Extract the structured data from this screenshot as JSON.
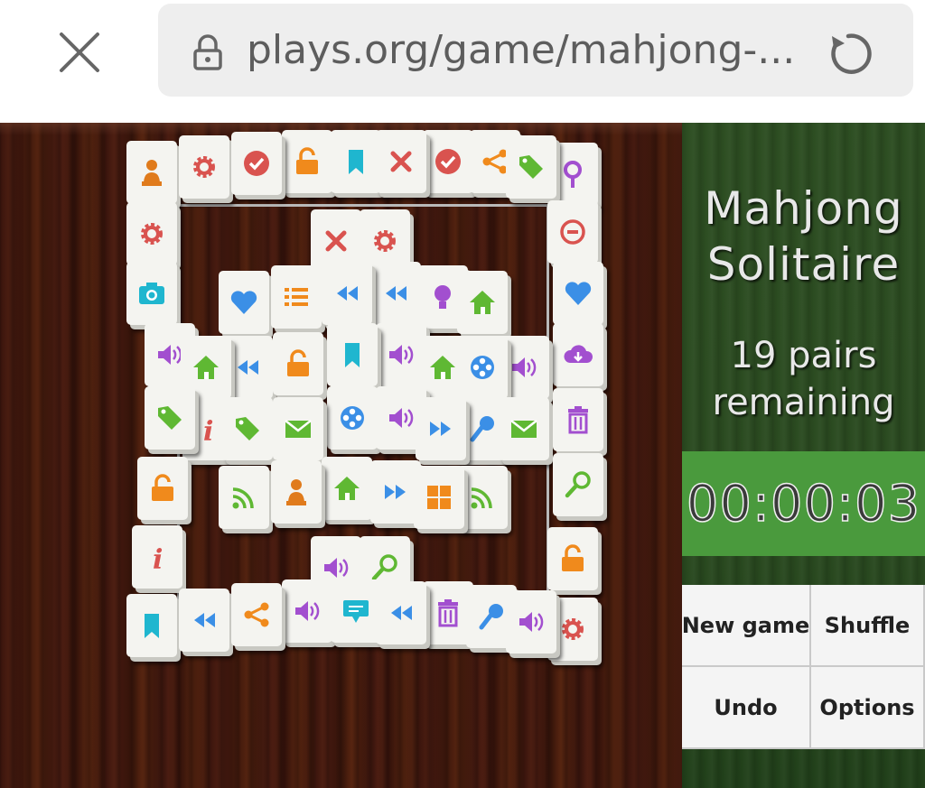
{
  "browser": {
    "url": "plays.org/game/mahjong-...",
    "close_icon": "close-icon",
    "lock_icon": "lock-icon",
    "reload_icon": "reload-icon"
  },
  "game": {
    "title_line1": "Mahjong",
    "title_line2": "Solitaire",
    "pairs_line1": "19 pairs",
    "pairs_line2": "remaining",
    "timer": "00:00:03",
    "buttons": {
      "new_game": "New game",
      "shuffle": "Shuffle",
      "undo": "Undo",
      "options": "Options"
    },
    "colors": {
      "timer_bg": "#4a9a3d",
      "panel_bg": "#2d4e22"
    },
    "tiles": [
      {
        "icon": "person",
        "color": "#e07b1c"
      },
      {
        "icon": "gear",
        "color": "#d9534f"
      },
      {
        "icon": "check",
        "color": "#d9534f"
      },
      {
        "icon": "unlock",
        "color": "#f08a1c"
      },
      {
        "icon": "bookmark",
        "color": "#1fb6cf"
      },
      {
        "icon": "x",
        "color": "#d9534f"
      },
      {
        "icon": "check",
        "color": "#d9534f"
      },
      {
        "icon": "share",
        "color": "#f08a1c"
      },
      {
        "icon": "tag",
        "color": "#5fb833"
      },
      {
        "icon": "pin",
        "color": "#a24fcf"
      },
      {
        "icon": "gear",
        "color": "#d9534f"
      },
      {
        "icon": "minus-circle",
        "color": "#d9534f"
      },
      {
        "icon": "x",
        "color": "#d9534f"
      },
      {
        "icon": "gear",
        "color": "#d9534f"
      },
      {
        "icon": "camera",
        "color": "#1fb6cf"
      },
      {
        "icon": "heart",
        "color": "#3b8fe6"
      },
      {
        "icon": "list",
        "color": "#f08a1c"
      },
      {
        "icon": "rewind",
        "color": "#3b8fe6"
      },
      {
        "icon": "rewind",
        "color": "#3b8fe6"
      },
      {
        "icon": "bulb",
        "color": "#a24fcf"
      },
      {
        "icon": "home",
        "color": "#5fb833"
      },
      {
        "icon": "heart",
        "color": "#3b8fe6"
      },
      {
        "icon": "volume",
        "color": "#a24fcf"
      },
      {
        "icon": "home",
        "color": "#5fb833"
      },
      {
        "icon": "rewind",
        "color": "#3b8fe6"
      },
      {
        "icon": "unlock",
        "color": "#f08a1c"
      },
      {
        "icon": "bookmark",
        "color": "#1fb6cf"
      },
      {
        "icon": "volume",
        "color": "#a24fcf"
      },
      {
        "icon": "home",
        "color": "#5fb833"
      },
      {
        "icon": "film",
        "color": "#3b8fe6"
      },
      {
        "icon": "volume",
        "color": "#a24fcf"
      },
      {
        "icon": "cloud",
        "color": "#a24fcf"
      },
      {
        "icon": "tag",
        "color": "#5fb833"
      },
      {
        "icon": "info",
        "color": "#d9534f"
      },
      {
        "icon": "tag",
        "color": "#5fb833"
      },
      {
        "icon": "mail",
        "color": "#5fb833"
      },
      {
        "icon": "film",
        "color": "#3b8fe6"
      },
      {
        "icon": "volume",
        "color": "#a24fcf"
      },
      {
        "icon": "forward",
        "color": "#3b8fe6"
      },
      {
        "icon": "mic",
        "color": "#3b8fe6"
      },
      {
        "icon": "mail",
        "color": "#5fb833"
      },
      {
        "icon": "trash",
        "color": "#a24fcf"
      },
      {
        "icon": "unlock",
        "color": "#f08a1c"
      },
      {
        "icon": "rss",
        "color": "#5fb833"
      },
      {
        "icon": "person",
        "color": "#e07b1c"
      },
      {
        "icon": "home",
        "color": "#5fb833"
      },
      {
        "icon": "forward",
        "color": "#3b8fe6"
      },
      {
        "icon": "grid",
        "color": "#f08a1c"
      },
      {
        "icon": "rss",
        "color": "#5fb833"
      },
      {
        "icon": "search",
        "color": "#5fb833"
      },
      {
        "icon": "info",
        "color": "#d9534f"
      },
      {
        "icon": "volume",
        "color": "#a24fcf"
      },
      {
        "icon": "search",
        "color": "#5fb833"
      },
      {
        "icon": "unlock",
        "color": "#f08a1c"
      },
      {
        "icon": "bookmark",
        "color": "#1fb6cf"
      },
      {
        "icon": "rewind",
        "color": "#3b8fe6"
      },
      {
        "icon": "share",
        "color": "#f08a1c"
      },
      {
        "icon": "volume",
        "color": "#a24fcf"
      },
      {
        "icon": "comment",
        "color": "#1fb6cf"
      },
      {
        "icon": "rewind",
        "color": "#3b8fe6"
      },
      {
        "icon": "trash",
        "color": "#a24fcf"
      },
      {
        "icon": "mic",
        "color": "#3b8fe6"
      },
      {
        "icon": "volume",
        "color": "#a24fcf"
      },
      {
        "icon": "gear",
        "color": "#d9534f"
      }
    ]
  }
}
